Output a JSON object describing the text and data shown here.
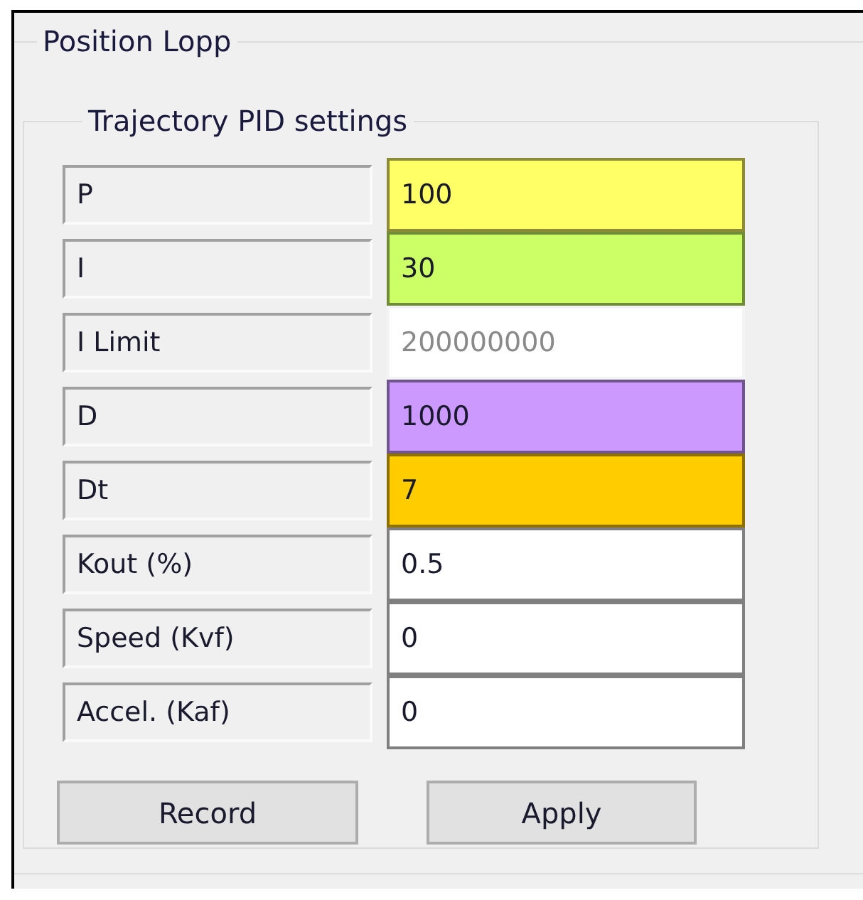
{
  "group": {
    "title": "Position Lopp"
  },
  "subgroup": {
    "title": "Trajectory PID settings"
  },
  "params": [
    {
      "label": "P",
      "value": "100",
      "color": "#ffff66",
      "disabled": false
    },
    {
      "label": "I",
      "value": "30",
      "color": "#ccff66",
      "disabled": false
    },
    {
      "label": "I Limit",
      "value": "200000000",
      "color": "#ffffff",
      "disabled": true
    },
    {
      "label": "D",
      "value": "1000",
      "color": "#cc99ff",
      "disabled": false
    },
    {
      "label": "Dt",
      "value": "7",
      "color": "#ffcc00",
      "disabled": false
    },
    {
      "label": "Kout (%)",
      "value": "0.5",
      "color": "#ffffff",
      "disabled": false
    },
    {
      "label": "Speed (Kvf)",
      "value": "0",
      "color": "#ffffff",
      "disabled": false
    },
    {
      "label": "Accel. (Kaf)",
      "value": "0",
      "color": "#ffffff",
      "disabled": false
    }
  ],
  "buttons": [
    "Record",
    "Apply"
  ]
}
